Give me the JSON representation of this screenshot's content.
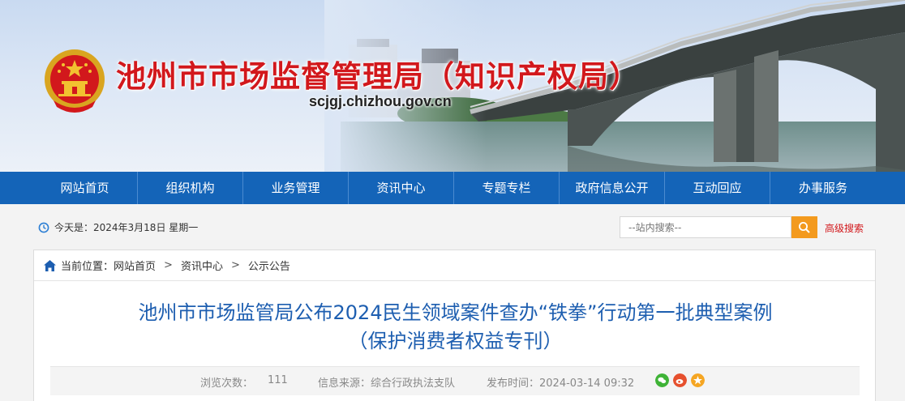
{
  "header": {
    "title": "池州市市场监督管理局（知识产权局）",
    "domain": "scjgj.chizhou.gov.cn"
  },
  "nav": {
    "items": [
      "网站首页",
      "组织机构",
      "业务管理",
      "资讯中心",
      "专题专栏",
      "政府信息公开",
      "互动回应",
      "办事服务"
    ]
  },
  "datebar": {
    "date_text": "今天是：2024年3月18日 星期一",
    "search_placeholder": "--站内搜索--",
    "advanced_search": "高级搜索"
  },
  "breadcrumb": {
    "prefix": "当前位置：",
    "items": [
      "网站首页",
      "资讯中心",
      "公示公告"
    ],
    "separator": ">"
  },
  "article": {
    "title_line1": "池州市市场监管局公布2024民生领域案件查办“铁拳”行动第一批典型案例",
    "title_line2": "（保护消费者权益专刊）",
    "views_label": "浏览次数：",
    "views": "111",
    "source": "信息来源：综合行政执法支队",
    "published": "发布时间：2024-03-14 09:32"
  },
  "colors": {
    "nav_blue": "#1464b8",
    "title_red": "#d2181c",
    "article_title_blue": "#1d5eb0",
    "search_orange": "#f39a1e"
  }
}
